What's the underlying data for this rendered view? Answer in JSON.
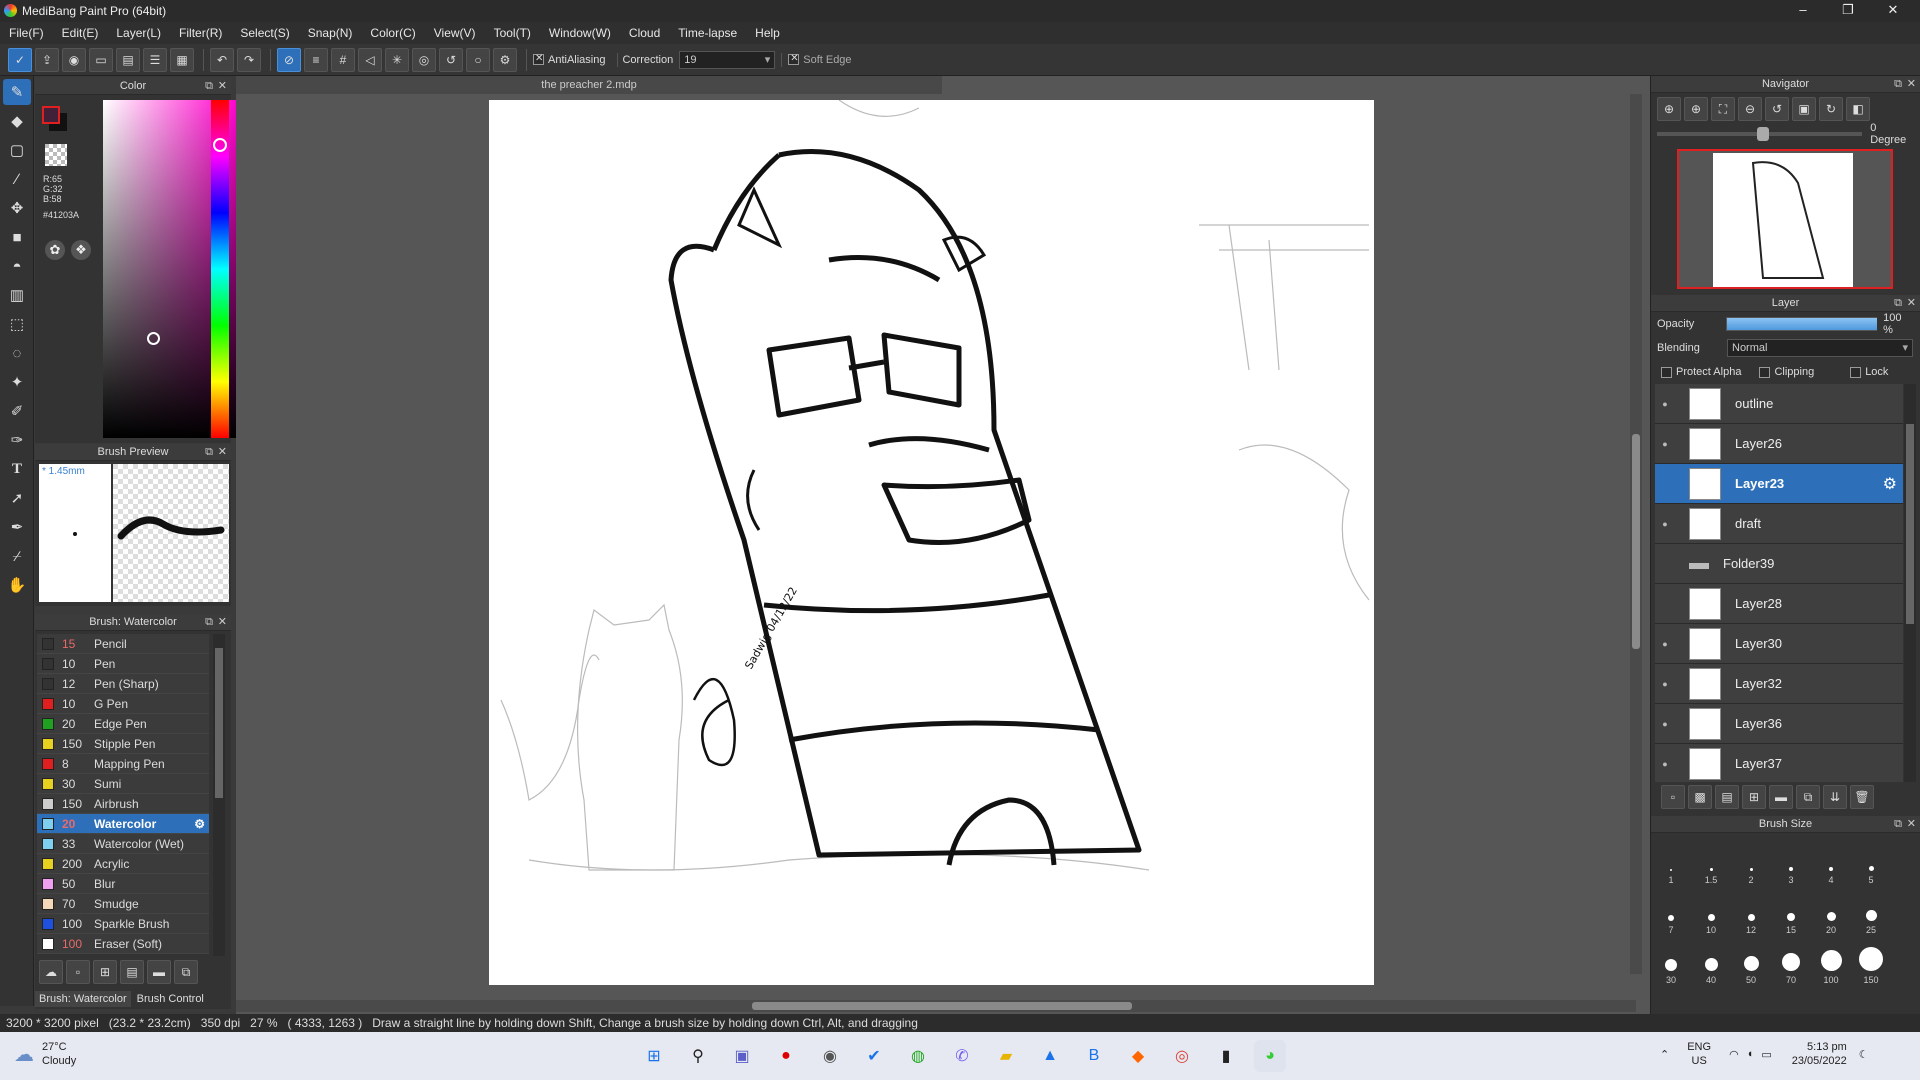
{
  "window": {
    "title": "MediBang Paint Pro (64bit)",
    "min": "–",
    "max": "❐",
    "close": "✕"
  },
  "menu": [
    "File(F)",
    "Edit(E)",
    "Layer(L)",
    "Filter(R)",
    "Select(S)",
    "Snap(N)",
    "Color(C)",
    "View(V)",
    "Tool(T)",
    "Window(W)",
    "Cloud",
    "Time-lapse",
    "Help"
  ],
  "toolbar": {
    "antialiasing": "AntiAliasing",
    "correction_label": "Correction",
    "correction_value": "19",
    "soft_edge": "Soft Edge"
  },
  "color_panel": {
    "title": "Color",
    "r": "R:65",
    "g": "G:32",
    "b": "B:58",
    "hex": "#41203A",
    "fg_color": "#41203A"
  },
  "brush_preview": {
    "title": "Brush Preview",
    "size": "* 1.45mm"
  },
  "brush_panel": {
    "title": "Brush: Watercolor",
    "items": [
      {
        "size": "15",
        "name": "Pencil",
        "color": "#333333",
        "red": true
      },
      {
        "size": "10",
        "name": "Pen",
        "color": "#333333",
        "red": false
      },
      {
        "size": "12",
        "name": "Pen (Sharp)",
        "color": "#333333",
        "red": false
      },
      {
        "size": "10",
        "name": "G Pen",
        "color": "#e02020",
        "red": false
      },
      {
        "size": "20",
        "name": "Edge Pen",
        "color": "#20a020",
        "red": false
      },
      {
        "size": "150",
        "name": "Stipple Pen",
        "color": "#e8d020",
        "red": false
      },
      {
        "size": "8",
        "name": "Mapping Pen",
        "color": "#e02020",
        "red": false
      },
      {
        "size": "30",
        "name": "Sumi",
        "color": "#e8d020",
        "red": false
      },
      {
        "size": "150",
        "name": "Airbrush",
        "color": "#cccccc",
        "red": false
      },
      {
        "size": "20",
        "name": "Watercolor",
        "color": "#7fd0f0",
        "red": true
      },
      {
        "size": "33",
        "name": "Watercolor (Wet)",
        "color": "#7fd0f0",
        "red": false
      },
      {
        "size": "200",
        "name": "Acrylic",
        "color": "#e8d020",
        "red": false
      },
      {
        "size": "50",
        "name": "Blur",
        "color": "#f0a0f0",
        "red": false
      },
      {
        "size": "70",
        "name": "Smudge",
        "color": "#f5d8b8",
        "red": false
      },
      {
        "size": "100",
        "name": "Sparkle Brush",
        "color": "#2050e0",
        "red": false
      },
      {
        "size": "100",
        "name": "Eraser (Soft)",
        "color": "#ffffff",
        "red": true
      }
    ],
    "tab_brush": "Brush: Watercolor",
    "tab_control": "Brush Control"
  },
  "document": {
    "tab": "the preacher 2.mdp",
    "signature": "Sadwig 04/12/22"
  },
  "navigator": {
    "title": "Navigator",
    "angle": "0 Degree"
  },
  "layer_panel": {
    "title": "Layer",
    "opacity_label": "Opacity",
    "opacity_value": "100 %",
    "opacity_fraction": 1.0,
    "blending_label": "Blending",
    "blending_value": "Normal",
    "protect_alpha": "Protect Alpha",
    "clipping": "Clipping",
    "lock": "Lock",
    "layers": [
      {
        "name": "outline",
        "visible": true,
        "selected": false,
        "folder": false
      },
      {
        "name": "Layer26",
        "visible": true,
        "selected": false,
        "folder": false
      },
      {
        "name": "Layer23",
        "visible": false,
        "selected": true,
        "folder": false
      },
      {
        "name": "draft",
        "visible": true,
        "selected": false,
        "folder": false
      },
      {
        "name": "Folder39",
        "visible": false,
        "selected": false,
        "folder": true
      },
      {
        "name": "Layer28",
        "visible": false,
        "selected": false,
        "folder": false
      },
      {
        "name": "Layer30",
        "visible": true,
        "selected": false,
        "folder": false
      },
      {
        "name": "Layer32",
        "visible": true,
        "selected": false,
        "folder": false
      },
      {
        "name": "Layer36",
        "visible": true,
        "selected": false,
        "folder": false
      },
      {
        "name": "Layer37",
        "visible": true,
        "selected": false,
        "folder": false
      }
    ]
  },
  "brush_size_panel": {
    "title": "Brush Size",
    "sizes": [
      "1",
      "1.5",
      "2",
      "3",
      "4",
      "5",
      "7",
      "10",
      "12",
      "15",
      "20",
      "25",
      "30",
      "40",
      "50",
      "70",
      "100",
      "150"
    ]
  },
  "status": {
    "dims": "3200 * 3200 pixel",
    "cm": "(23.2 * 23.2cm)",
    "dpi": "350 dpi",
    "zoom": "27 %",
    "coords": "( 4333, 1263 )",
    "hint": "Draw a straight line by holding down Shift, Change a brush size by holding down Ctrl, Alt, and dragging"
  },
  "taskbar": {
    "weather_temp": "27°C",
    "weather_desc": "Cloudy",
    "lang": "ENG",
    "region": "US",
    "time": "5:13 pm",
    "date": "23/05/2022"
  }
}
